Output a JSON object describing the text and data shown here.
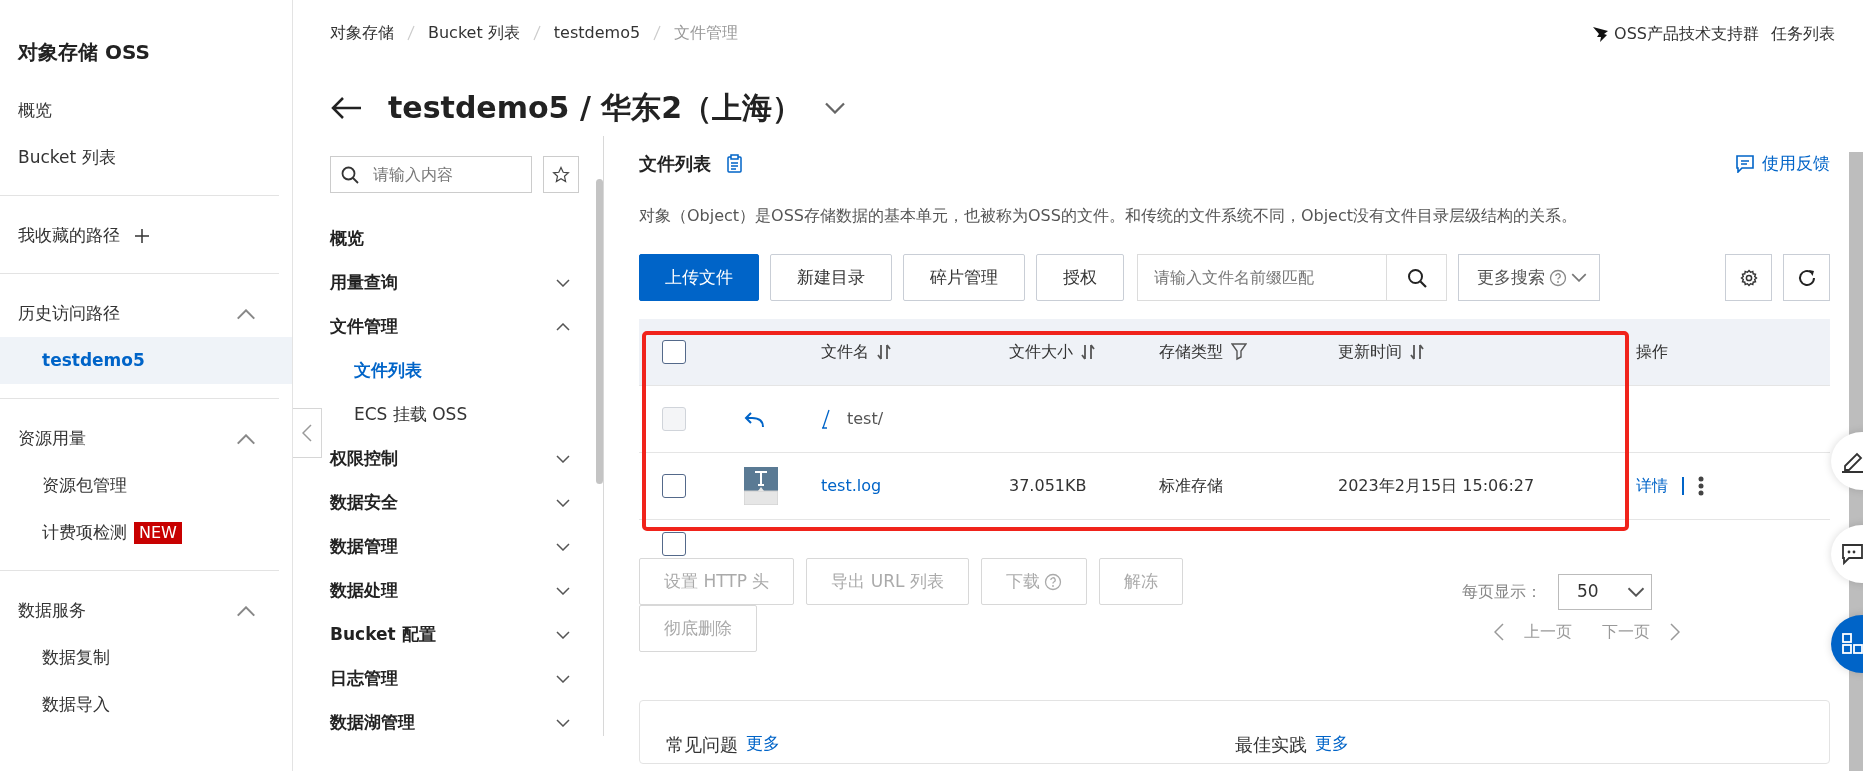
{
  "sidebar": {
    "title": "对象存储 OSS",
    "top_items": [
      {
        "label": "概览",
        "selected": false
      },
      {
        "label": "Bucket 列表",
        "selected": false
      }
    ],
    "groups": [
      {
        "label": "我收藏的路径",
        "kind": "add"
      },
      {
        "label": "历史访问路径",
        "kind": "collapsible",
        "expanded": true,
        "items": [
          {
            "label": "testdemo5",
            "selected": true
          }
        ]
      },
      {
        "label": "资源用量",
        "kind": "collapsible",
        "expanded": true,
        "items": [
          {
            "label": "资源包管理",
            "selected": false
          },
          {
            "label": "计费项检测",
            "badge": "NEW",
            "selected": false
          }
        ]
      },
      {
        "label": "数据服务",
        "kind": "collapsible",
        "expanded": true,
        "items": [
          {
            "label": "数据复制",
            "selected": false
          },
          {
            "label": "数据导入",
            "selected": false
          }
        ]
      }
    ]
  },
  "header": {
    "breadcrumb": [
      "对象存储",
      "Bucket 列表",
      "testdemo5",
      "文件管理"
    ],
    "top_links": [
      {
        "label": "OSS产品技术支持群",
        "kind": "group"
      },
      {
        "label": "任务列表",
        "kind": "plain"
      }
    ],
    "title": "testdemo5 / 华东2（上海）"
  },
  "bucket_nav": {
    "search": {
      "placeholder": "请输入内容"
    },
    "items": [
      {
        "label": "概览",
        "kind": "link"
      },
      {
        "label": "用量查询",
        "kind": "group",
        "expanded": false
      },
      {
        "label": "文件管理",
        "kind": "group",
        "expanded": true,
        "children": [
          {
            "label": "文件列表",
            "selected": true
          },
          {
            "label": "ECS 挂载 OSS",
            "selected": false
          }
        ]
      },
      {
        "label": "权限控制",
        "kind": "group",
        "expanded": false
      },
      {
        "label": "数据安全",
        "kind": "group",
        "expanded": false
      },
      {
        "label": "数据管理",
        "kind": "group",
        "expanded": false
      },
      {
        "label": "数据处理",
        "kind": "group",
        "expanded": false
      },
      {
        "label": "Bucket 配置",
        "kind": "group",
        "expanded": false
      },
      {
        "label": "日志管理",
        "kind": "group",
        "expanded": false
      },
      {
        "label": "数据湖管理",
        "kind": "group",
        "expanded": false
      }
    ]
  },
  "panel": {
    "title": "文件列表",
    "feedback": "使用反馈",
    "description": "对象（Object）是OSS存储数据的基本单元，也被称为OSS的文件。和传统的文件系统不同，Object没有文件目录层级结构的关系。",
    "toolbar": [
      {
        "label": "上传文件",
        "kind": "primary"
      },
      {
        "label": "新建目录",
        "kind": "default"
      },
      {
        "label": "碎片管理",
        "kind": "default"
      },
      {
        "label": "授权",
        "kind": "default"
      }
    ],
    "search": {
      "placeholder": "请输入文件名前缀匹配"
    },
    "more_search": "更多搜索",
    "table": {
      "highlighted": true,
      "header_checked": false,
      "columns": [
        {
          "label": "文件名",
          "kind": "sort"
        },
        {
          "label": "文件大小",
          "kind": "sort"
        },
        {
          "label": "存储类型",
          "kind": "filter"
        },
        {
          "label": "更新时间",
          "kind": "sort"
        },
        {
          "label": "操作",
          "kind": "plain"
        }
      ],
      "rows": [
        {
          "kind": "parent",
          "path": "test/",
          "checked": false,
          "disabled": true
        },
        {
          "kind": "file",
          "name": "test.log",
          "size": "37.051KB",
          "storage": "标准存储",
          "updated": "2023年2月15日 15:06:27",
          "action": "详情",
          "checked": false,
          "disabled": false
        }
      ]
    },
    "select_all_checked": false,
    "batch_buttons": [
      {
        "label": "设置 HTTP 头",
        "disabled": true,
        "help": false
      },
      {
        "label": "导出 URL 列表",
        "disabled": true,
        "help": false
      },
      {
        "label": "下载",
        "disabled": true,
        "help": true
      },
      {
        "label": "解冻",
        "disabled": true,
        "help": false
      },
      {
        "label": "彻底删除",
        "disabled": true,
        "help": false
      }
    ],
    "pagination": {
      "label": "每页显示：",
      "page_size": "50",
      "prev": "上一页",
      "next": "下一页",
      "prev_disabled": true,
      "next_disabled": true
    },
    "sections": [
      {
        "title": "常见问题",
        "more": "更多"
      },
      {
        "title": "最佳实践",
        "more": "更多"
      }
    ]
  }
}
